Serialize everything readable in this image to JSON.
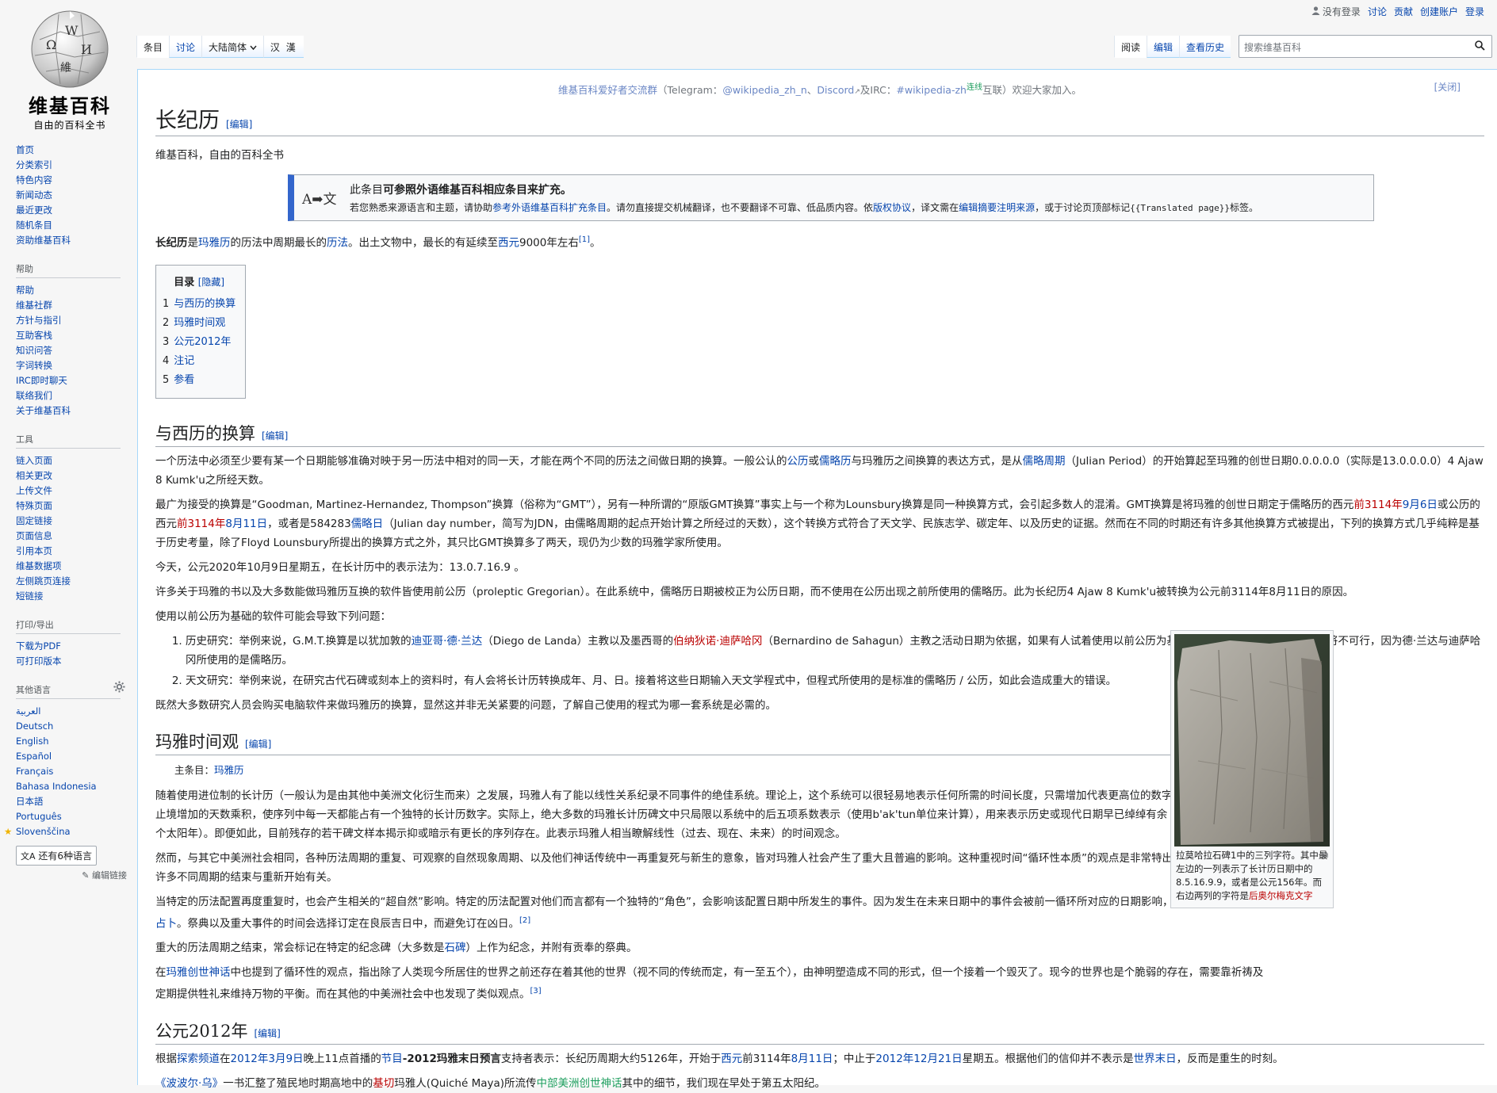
{
  "logo": {
    "name": "维基百科",
    "tagline": "自由的百科全书",
    "globe_letters": [
      "Ω",
      "W",
      "И",
      "維"
    ]
  },
  "personal": {
    "not_logged": "没有登录",
    "talk": "讨论",
    "contributions": "贡献",
    "create_account": "创建账户",
    "login": "登录"
  },
  "tabs_left": [
    {
      "label": "条目",
      "selected": true
    },
    {
      "label": "讨论",
      "selected": false
    },
    {
      "label": "大陆简体",
      "dropdown": true
    },
    {
      "label": "汉 漢"
    }
  ],
  "tabs_right": [
    {
      "label": "阅读",
      "selected": true
    },
    {
      "label": "编辑"
    },
    {
      "label": "查看历史"
    }
  ],
  "search": {
    "placeholder": "搜索维基百科"
  },
  "sidebar": {
    "main": [
      "首页",
      "分类索引",
      "特色内容",
      "新闻动态",
      "最近更改",
      "随机条目",
      "资助维基百科"
    ],
    "help_title": "帮助",
    "help": [
      "帮助",
      "维基社群",
      "方针与指引",
      "互助客栈",
      "知识问答",
      "字词转换",
      "IRC即时聊天",
      "联络我们",
      "关于维基百科"
    ],
    "tools_title": "工具",
    "tools": [
      "链入页面",
      "相关更改",
      "上传文件",
      "特殊页面",
      "固定链接",
      "页面信息",
      "引用本页",
      "维基数据项",
      "左侧跳页连接",
      "短链接"
    ],
    "print_title": "打印/导出",
    "print": [
      "下载为PDF",
      "可打印版本"
    ],
    "lang_title": "其他语言",
    "langs": [
      "العربية",
      "Deutsch",
      "English",
      "Español",
      "Français",
      "Bahasa Indonesia",
      "日本語",
      "Português",
      "Slovenščina"
    ],
    "lang_more": "还有6种语言",
    "edit_links": "编辑链接"
  },
  "sitenotice": {
    "group": "维基百科爱好者交流群",
    "text_a": "（Telegram：",
    "tg": "@wikipedia_zh_n",
    "text_b": "、",
    "discord": "Discord",
    "text_c": "及IRC：",
    "irc": "#wikipedia-zh",
    "connected": "连线",
    "text_d": "互联）欢迎大家加入。",
    "close": "[关闭]"
  },
  "article": {
    "title": "长纪历",
    "edit": "[编辑]",
    "tagline": "维基百科，自由的百科全书",
    "ambox": {
      "icon": "A➡文",
      "title_a": "此条目",
      "title_b": "可参照外语维基百科相应条目来扩充。",
      "body_a": "若您熟悉来源语言和主题，请协助",
      "body_link1": "参考外语维基百科扩充条目",
      "body_b": "。请勿直接提交机械翻译，也不要翻译不可靠、低品质内容。依",
      "body_link2": "版权协议",
      "body_c": "，译文需在",
      "body_link3": "编辑摘要注明来源",
      "body_d": "，或于讨论页顶部标记",
      "body_code": "{{Translated page}}",
      "body_e": "标签。"
    },
    "lead": {
      "bold": "长纪历",
      "a": "是",
      "l1": "玛雅历",
      "b": "的历法中周期最长的",
      "l2": "历法",
      "c": "。出土文物中，最长的有延续至",
      "l3": "西元",
      "d": "9000年左右",
      "ref": "[1]",
      "e": "。"
    },
    "toc": {
      "title": "目录",
      "hide": "[隐藏]",
      "items": [
        {
          "num": "1",
          "label": "与西历的换算"
        },
        {
          "num": "2",
          "label": "玛雅时间观"
        },
        {
          "num": "3",
          "label": "公元2012年"
        },
        {
          "num": "4",
          "label": "注记"
        },
        {
          "num": "5",
          "label": "参看"
        }
      ]
    },
    "s1": {
      "title": "与西历的换算",
      "p1a": "一个历法中必须至少要有某一个日期能够准确对映于另一历法中相对的同一天，才能在两个不同的历法之间做日期的换算。一般公认的",
      "p1l1": "公历",
      "p1b": "或",
      "p1l2": "儒略历",
      "p1c": "与玛雅历之间换算的表达方式，是从",
      "p1l3": "儒略周期",
      "p1d": "（Julian Period）的开始算起至玛雅的创世日期0.0.0.0.0（实际是13.0.0.0.0）4 Ajaw 8 Kumk'u之所经天数。",
      "p2a": "最广为接受的换算是“Goodman, Martinez-Hernandez, Thompson”换算（俗称为“GMT”），另有一种所谓的“原版GMT换算”事实上与一个称为Lounsbury换算是同一种换算方式，会引起多数人的混淆。GMT换算是将玛雅的创世日期定于儒略历的西元",
      "p2r1": "前3114年",
      "p2l1": "9月6日",
      "p2b": "或公历的西元",
      "p2r2": "前3114年",
      "p2l2": "8月11日",
      "p2c": "，或者是584283",
      "p2l3": "儒略日",
      "p2d": "（Julian day number，简写为JDN，由儒略周期的起点开始计算之所经过的天数），这个转换方式符合了天文学、民族志学、碳定年、以及历史的证据。然而在不同的时期还有许多其他换算方式被提出，下列的换算方式几乎纯粹是基于历史考量，除了Floyd Lounsbury所提出的换算方式之外，其只比GMT换算多了两天，现仍为少数的玛雅学家所使用。",
      "p3": "今天，公元2020年10月9日星期五，在长计历中的表示法为：13.0.7.16.9 。",
      "p4": "许多关于玛雅的书以及大多数能做玛雅历互换的软件皆使用前公历（proleptic Gregorian）。在此系统中，儒略历日期被校正为公历日期，而不使用在公历出现之前所使用的儒略历。此为长纪历4 Ajaw 8 Kumk'u被转换为公元前3114年8月11日的原因。",
      "p5": "使用以前公历为基础的软件可能会导致下列问题：",
      "li1a": "历史研究：举例来说，G.M.T.换算是以犹加敦的",
      "li1l1": "迪亚哥·德·兰达",
      "li1b": "（Diego de Landa）主教以及墨西哥的",
      "li1r1": "伯纳狄诺·迪萨哈冈",
      "li1c": "（Bernardino de Sahagun）主教之活动日期为依据，如果有人试着使用以前公历为基础的程式来取得正确的换算，此将不可行，因为德·兰达与迪萨哈冈所使用的是儒略历。",
      "li2": "天文研究：举例来说，在研究古代石碑或刻本上的资料时，有人会将长计历转换成年、月、日。接着将这些日期输入天文学程式中，但程式所使用的是标准的儒略历 / 公历，如此会造成重大的错误。",
      "p6": "既然大多数研究人员会购买电脑软件来做玛雅历的换算，显然这并非无关紧要的问题，了解自己使用的程式为哪一套系统是必需的。"
    },
    "s2": {
      "title": "玛雅时间观",
      "hatnote_a": "主条目：",
      "hatnote_link": "玛雅历",
      "p1": "随着使用进位制的长计历（一般认为是由其他中美洲文化衍生而来）之发展，玛雅人有了能以线性关系纪录不同事件的绝佳系统。理论上，这个系统可以很轻易地表示任何所需的时间长度，只需增加代表更高位的数字即可，而借此产生无止境增加的天数乘积，使序列中每一天都能占有一个独特的长计历数字。实际上，绝大多数的玛雅长计历碑文中只局限以系统中的后五项系数表示（使用b'ak'tun单位来计算），用来表示历史或现代日期早已绰绰有余（周期大约相当5126个太阳年）。即便如此，目前残存的若干碑文样本揭示抑或暗示有更长的序列存在。此表示玛雅人相当瞭解线性（过去、现在、未来）的时间观念。",
      "p2": "然而，与其它中美洲社会相同，各种历法周期的重复、可观察的自然现象周期、以及他们神话传统中一再重复死与新生的意象，皆对玛雅人社会产生了重大且普遍的影响。这种重视时间“循环性本质”的观点是非常特出的，且许多祭典是与许多不同周期的结束与重新开始有关。",
      "p3a": "当特定的历法配置再度重复时，也会产生相关的“超自然”影响。特定的历法配置对他们而言都有一个独特的“角色”，会影响该配置日期中所发生的事件。因为发生在未来日期中的事件会被前一循环所对应的日期影响，所以可借此",
      "p3r1": "预兆",
      "p3b": "做出",
      "p3l1": "占卜",
      "p3c": "。祭典以及重大事件的时间会选择订定在良辰吉日中，而避免订在凶日。",
      "p3ref": "[2]",
      "p4a": "重大的历法周期之结束，常会标记在特定的纪念碑（大多数是",
      "p4l1": "石碑",
      "p4b": "）上作为纪念，并附有贡奉的祭典。",
      "p5a": "在",
      "p5l1": "玛雅创世神话",
      "p5b": "中也提到了循环性的观点，指出除了人类现今所居住的世界之前还存在着其他的世界（视不同的传统而定，有一至五个），由神明塑造成不同的形式，但一个接着一个毁灭了。现今的世界也是个脆弱的存在，需要靠祈祷及定期提供牲礼来维持万物的平衡。而在其他的中美洲社会中也发现了类似观点。",
      "p5ref": "[3]"
    },
    "s3": {
      "title": "公元2012年",
      "p1a": "根据",
      "p1l1": "探索频道",
      "p1b": "在",
      "p1l2": "2012年3月9日",
      "p1c": "晚上11点首播的",
      "p1l3": "节目",
      "p1bold": "-2012玛雅末日预言",
      "p1d": "支持者表示：长纪历周期大约5126年，开始于",
      "p1l4": "西元",
      "p1e": "前3114年",
      "p1l5": "8月11日",
      "p1f": "；中止于",
      "p1l6": "2012年12月21日",
      "p1g": "星期五。根据他们的信仰并不表示是",
      "p1l7": "世界末日",
      "p1h": "，反而是重生的时刻。",
      "p2l1": "《波波尔·乌》",
      "p2a": "一书汇整了殖民地时期高地中的",
      "p2r1": "基切",
      "p2b": "玛雅人(Quiché Maya)所流传",
      "p2g1": "中部美洲创世神话",
      "p2c": "其中的细节，我们现在早处于第五太阳纪。"
    },
    "figure": {
      "caption_a": "拉莫哈拉石碑1中的三列字符。其中最左边的一列表示了长计历日期中的8.5.16.9.9，或者是公元156年。而右边两列的字符是",
      "caption_link": "后奥尔梅克文字"
    }
  }
}
